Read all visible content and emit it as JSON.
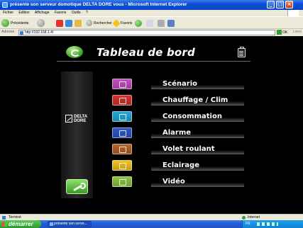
{
  "window": {
    "title": "présente son serveur domotique DELTA DORE vous - Microsoft Internet Explorer",
    "buttons": [
      "_",
      "□",
      "×"
    ]
  },
  "menubar": [
    "Fichier",
    "Edition",
    "Affichage",
    "Favoris",
    "Outils",
    "?"
  ],
  "toolbar": {
    "back_label": "Précédente",
    "search_label": "Rechercher",
    "favorites_label": "Favoris"
  },
  "addressbar": {
    "label": "Adresse",
    "url": "http://192.168.1.4/",
    "go_label": "OK",
    "links_label": "Liens"
  },
  "dashboard": {
    "title": "Tableau de bord",
    "brand_line1": "DELTA",
    "brand_line2": "DORE",
    "menu": [
      {
        "label": "Scénario",
        "icon": "scenario-icon",
        "color": "#c24ec4"
      },
      {
        "label": "Chauffage / Clim",
        "icon": "thermometer-icon",
        "color": "#d6322f"
      },
      {
        "label": "Consommation",
        "icon": "consumption-chart-icon",
        "color": "#22a8d8"
      },
      {
        "label": "Alarme",
        "icon": "alarm-house-icon",
        "color": "#2f55c8"
      },
      {
        "label": "Volet roulant",
        "icon": "shutter-icon",
        "color": "#b8642a"
      },
      {
        "label": "Eclairage",
        "icon": "lightbulb-icon",
        "color": "#f2c21a"
      },
      {
        "label": "Vidéo",
        "icon": "video-icon",
        "color": "#8cc63e"
      }
    ]
  },
  "statusbar": {
    "status": "Terminé",
    "zone": "Internet"
  },
  "taskbar": {
    "start_label": "démarrer",
    "task_label": "présente son serve...",
    "lang": "FR",
    "clock": ""
  }
}
